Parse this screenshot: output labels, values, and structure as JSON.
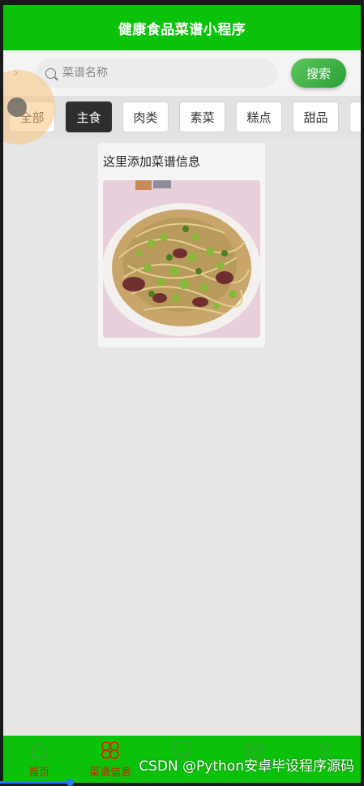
{
  "app": {
    "title": "健康食品菜谱小程序"
  },
  "search": {
    "back_icon": "chevron-right-icon",
    "placeholder": "菜谱名称",
    "value": "",
    "button_label": "搜索"
  },
  "categories": [
    {
      "label": "全部",
      "active": false
    },
    {
      "label": "主食",
      "active": true
    },
    {
      "label": "肉类",
      "active": false
    },
    {
      "label": "素菜",
      "active": false
    },
    {
      "label": "糕点",
      "active": false
    },
    {
      "label": "甜品",
      "active": false
    }
  ],
  "recipes": [
    {
      "title": "这里添加菜谱信息",
      "image": "stir-fried-bean-sprouts-with-meat-photo"
    }
  ],
  "tabbar": {
    "items": [
      {
        "label": "首页",
        "icon": "home-icon"
      },
      {
        "label": "菜谱信息",
        "icon": "clover-icon"
      },
      {
        "label": "",
        "icon": "monitor-icon"
      },
      {
        "label": "",
        "icon": "cube-icon"
      },
      {
        "label": "",
        "icon": "user-icon"
      }
    ]
  },
  "watermark": "CSDN @Python安卓毕设程序源码",
  "colors": {
    "primary_green": "#0bc20b",
    "active_tab": "#2e2e2e",
    "tabbar_label": "#d81e06",
    "background": "#e6e6e6"
  }
}
